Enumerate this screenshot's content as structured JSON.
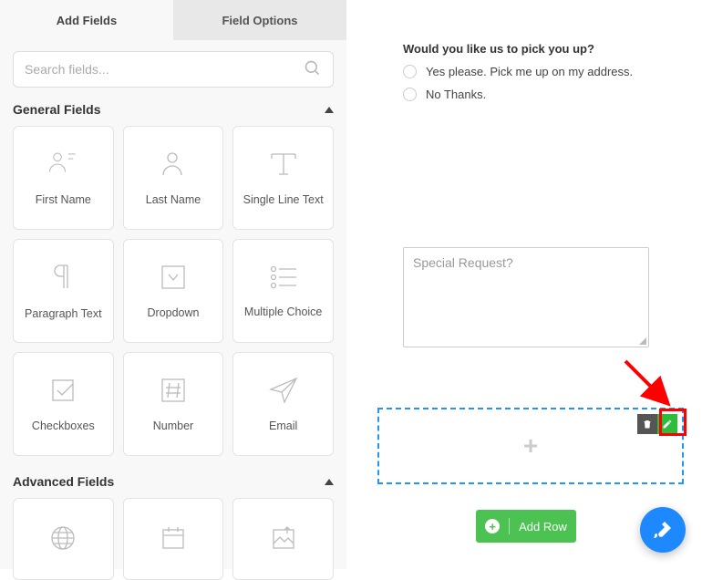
{
  "tabs": {
    "add_fields": "Add Fields",
    "field_options": "Field Options"
  },
  "search": {
    "placeholder": "Search fields..."
  },
  "sections": {
    "general": {
      "title": "General Fields",
      "fields": [
        {
          "label": "First Name"
        },
        {
          "label": "Last Name"
        },
        {
          "label": "Single Line Text"
        },
        {
          "label": "Paragraph Text"
        },
        {
          "label": "Dropdown"
        },
        {
          "label": "Multiple Choice"
        },
        {
          "label": "Checkboxes"
        },
        {
          "label": "Number"
        },
        {
          "label": "Email"
        }
      ]
    },
    "advanced": {
      "title": "Advanced Fields"
    }
  },
  "form": {
    "question": "Would you like us to pick you up?",
    "option1": "Yes please. Pick me up on my address.",
    "option2": "No Thanks.",
    "textarea_placeholder": "Special Request?"
  },
  "buttons": {
    "add_row": "Add Row"
  }
}
